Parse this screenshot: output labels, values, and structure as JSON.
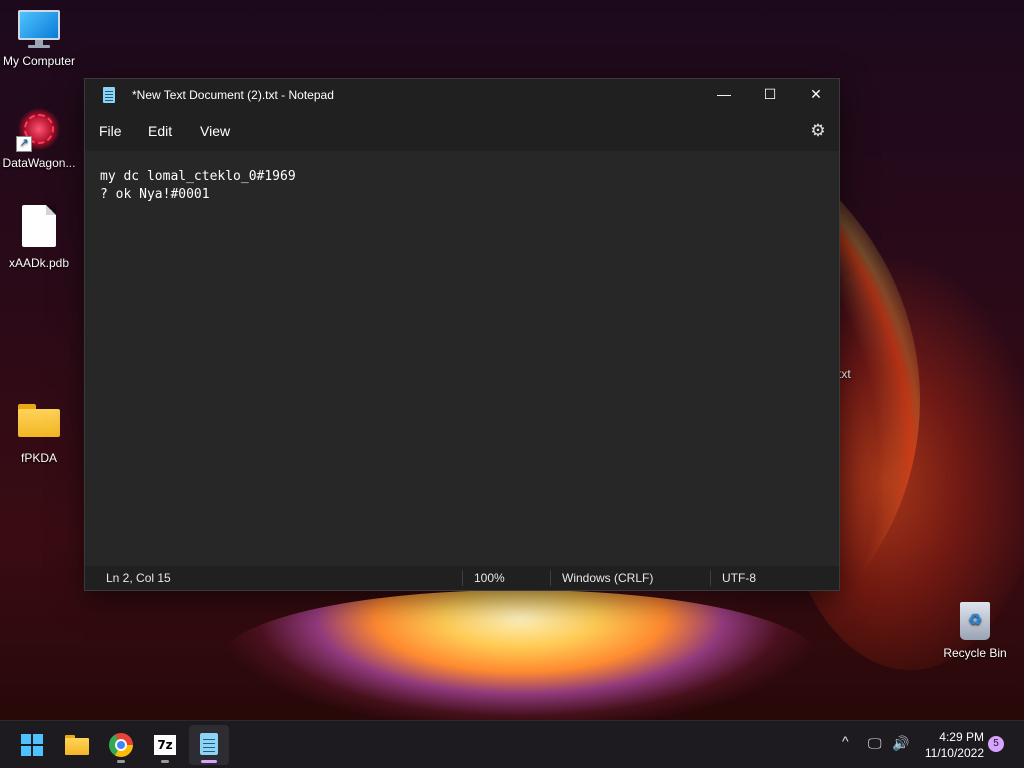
{
  "desktop": {
    "icons": [
      {
        "label": "My Computer",
        "icon": "computer-icon"
      },
      {
        "label": "DataWagon...",
        "icon": "datawagon-shortcut-icon"
      },
      {
        "label": "xAADk.pdb",
        "icon": "file-icon"
      },
      {
        "label": "fPKDA",
        "icon": "folder-icon"
      },
      {
        "label": "Recycle Bin",
        "icon": "recycle-bin-icon"
      }
    ],
    "partial_label": "txt"
  },
  "notepad": {
    "title": "*New Text Document (2).txt - Notepad",
    "window_buttons": {
      "minimize": "—",
      "maximize": "☐",
      "close": "✕"
    },
    "menu": [
      "File",
      "Edit",
      "View"
    ],
    "settings_icon": "⚙",
    "content_lines": [
      "my dc lomal_cteklo_0#1969",
      "? ok Nya!#0001"
    ],
    "status": {
      "position": "Ln 2, Col 15",
      "zoom": "100%",
      "line_ending": "Windows (CRLF)",
      "encoding": "UTF-8"
    }
  },
  "taskbar": {
    "apps": [
      {
        "name": "Start",
        "icon": "windows-start-icon"
      },
      {
        "name": "File Explorer",
        "icon": "file-explorer-icon"
      },
      {
        "name": "Google Chrome",
        "icon": "chrome-icon"
      },
      {
        "name": "7-Zip",
        "icon": "7zip-icon",
        "text": "7z"
      },
      {
        "name": "Notepad",
        "icon": "notepad-icon",
        "active": true
      }
    ],
    "tray": {
      "chevron": "^",
      "network_icon": "🖵",
      "volume_icon": "🔊"
    },
    "time": "4:29 PM",
    "date": "11/10/2022",
    "notification_count": "5"
  },
  "colors": {
    "accent": "#d6a3ff",
    "window_bg": "#272727",
    "titlebar_bg": "#202020",
    "taskbar_bg": "#1d1b20"
  }
}
